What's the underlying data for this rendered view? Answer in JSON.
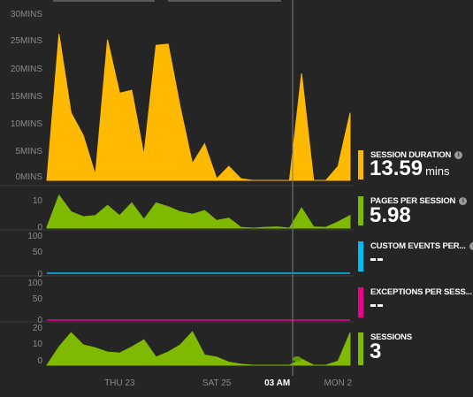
{
  "chart_data": [
    {
      "type": "area",
      "ylabel": "",
      "yticks": [
        "0MINS",
        "5MINS",
        "10MINS",
        "15MINS",
        "20MINS",
        "25MINS",
        "30MINS"
      ],
      "ylim": [
        0,
        30
      ],
      "color": "#FFB900",
      "series": [
        {
          "values": [
            0,
            26,
            12,
            8,
            1,
            25,
            15.5,
            16,
            4.5,
            24,
            24.2,
            13,
            3,
            6.5,
            0.3,
            2.5,
            0.3,
            0,
            0,
            0,
            0,
            19,
            0,
            0,
            2.5,
            12
          ]
        }
      ]
    },
    {
      "type": "area",
      "yticks": [
        "10",
        "0"
      ],
      "ylim": [
        0,
        14
      ],
      "color": "#7FBA00",
      "series": [
        {
          "values": [
            0.3,
            13,
            6.5,
            4.5,
            5,
            9,
            5,
            10,
            3.5,
            10,
            8.5,
            6.5,
            5.5,
            7,
            3,
            4,
            0.3,
            0,
            0.3,
            0.5,
            0,
            8,
            0.5,
            0.3,
            2.5,
            5
          ]
        }
      ]
    },
    {
      "type": "line",
      "yticks": [
        "100",
        "50",
        "0"
      ],
      "ylim": [
        0,
        100
      ],
      "color": "#00BCF2",
      "series": [
        {
          "values": [
            0,
            0
          ]
        }
      ]
    },
    {
      "type": "line",
      "yticks": [
        "100",
        "50",
        "0"
      ],
      "ylim": [
        0,
        100
      ],
      "color": "#EC008C",
      "series": [
        {
          "values": [
            0,
            0
          ]
        }
      ]
    },
    {
      "type": "area",
      "yticks": [
        "20",
        "10",
        "0"
      ],
      "ylim": [
        0,
        20
      ],
      "color": "#7FBA00",
      "series": [
        {
          "values": [
            0,
            9,
            16,
            10,
            8.5,
            6.5,
            6,
            9,
            12.5,
            4,
            6.5,
            10,
            16.5,
            5,
            4,
            1.5,
            0.5,
            0,
            0,
            0,
            0,
            3,
            0,
            0,
            2,
            16
          ]
        }
      ]
    }
  ],
  "x_axis": {
    "ticks": [
      {
        "label": "THU 23",
        "highlight": false,
        "i": 6
      },
      {
        "label": "SAT 25",
        "highlight": false,
        "i": 14
      },
      {
        "label": "03 AM",
        "highlight": true,
        "i": 19
      },
      {
        "label": "MON 2",
        "highlight": false,
        "i": 24
      }
    ]
  },
  "metrics": [
    {
      "name": "SESSION DURATION",
      "value": "13.59",
      "unit": "mins",
      "color": "#FFB900"
    },
    {
      "name": "PAGES PER SESSION",
      "value": "5.98",
      "unit": "",
      "color": "#7FBA00"
    },
    {
      "name": "CUSTOM EVENTS PER...",
      "value": "--",
      "unit": "",
      "color": "#00BCF2"
    },
    {
      "name": "EXCEPTIONS PER SESS...",
      "value": "--",
      "unit": "",
      "color": "#EC008C"
    },
    {
      "name": "SESSIONS",
      "value": "3",
      "unit": "",
      "color": "#7FBA00"
    }
  ]
}
